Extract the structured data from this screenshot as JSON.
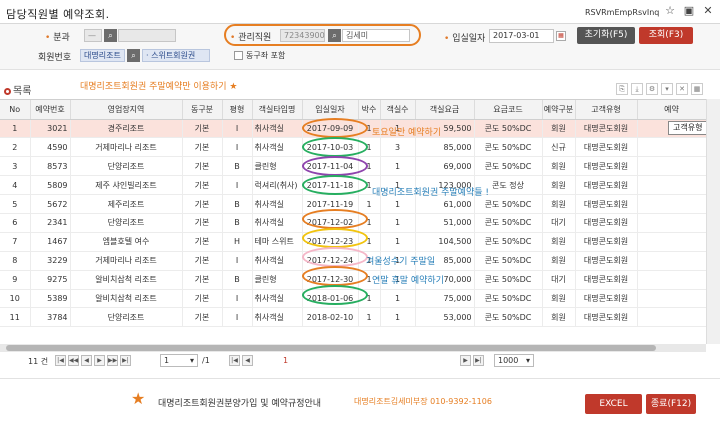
{
  "window": {
    "title": "담당직원별 예약조회.",
    "screen_id": "RSVRmEmpRsvInq"
  },
  "search": {
    "category_label": "분과",
    "category_value": "—",
    "manager_label": "관리직원",
    "manager_code": "72343900",
    "manager_name": "김세미",
    "checkin_label": "입실일자",
    "checkin_date": "2017-03-01",
    "member_no_label": "회원번호",
    "member_tag1": "대명리조트",
    "member_tag2": "스위트회원권",
    "companion_label": "동구좌 포함",
    "reset_label": "초기화(F5)",
    "query_label": "조회(F3)"
  },
  "list": {
    "title": "목록",
    "annotation": "대명리조트회원권 주말예약만 이용하기 ★"
  },
  "columns": [
    "No",
    "예약번호",
    "영업장지역",
    "동구분",
    "평형",
    "객실타입명",
    "입실일자",
    "박수",
    "객실수",
    "객실요금",
    "요금코드",
    "예약구분",
    "고객유형",
    "예약"
  ],
  "rows": [
    {
      "no": "1",
      "rsv": "3021",
      "site": "경주리조트",
      "dong": "기본",
      "py": "I",
      "type": "취사객실",
      "date": "2017-09-09",
      "nights": "1",
      "rooms": "1",
      "fee": "59,500",
      "code": "콘도 50%DC",
      "kind": "회원",
      "cust": "대명콘도회원"
    },
    {
      "no": "2",
      "rsv": "4590",
      "site": "거제마리나 리조트",
      "dong": "기본",
      "py": "I",
      "type": "취사객실",
      "date": "2017-10-03",
      "nights": "1",
      "rooms": "3",
      "fee": "85,000",
      "code": "콘도 50%DC",
      "kind": "신규",
      "cust": "대명콘도회원"
    },
    {
      "no": "3",
      "rsv": "8573",
      "site": "단양리조트",
      "dong": "기본",
      "py": "B",
      "type": "클린형",
      "date": "2017-11-04",
      "nights": "1",
      "rooms": "1",
      "fee": "69,000",
      "code": "콘도 50%DC",
      "kind": "회원",
      "cust": "대명콘도회원"
    },
    {
      "no": "4",
      "rsv": "5809",
      "site": "제주 샤인빌리조트",
      "dong": "기본",
      "py": "I",
      "type": "럭셔리(취사)",
      "date": "2017-11-18",
      "nights": "1",
      "rooms": "1",
      "fee": "123,000",
      "code": "콘도 정상",
      "kind": "회원",
      "cust": "대명콘도회원"
    },
    {
      "no": "5",
      "rsv": "5672",
      "site": "제주리조트",
      "dong": "기본",
      "py": "B",
      "type": "취사객실",
      "date": "2017-11-19",
      "nights": "1",
      "rooms": "1",
      "fee": "61,000",
      "code": "콘도 50%DC",
      "kind": "회원",
      "cust": "대명콘도회원"
    },
    {
      "no": "6",
      "rsv": "2341",
      "site": "단양리조트",
      "dong": "기본",
      "py": "B",
      "type": "취사객실",
      "date": "2017-12-02",
      "nights": "1",
      "rooms": "1",
      "fee": "51,000",
      "code": "콘도 50%DC",
      "kind": "대기",
      "cust": "대명콘도회원"
    },
    {
      "no": "7",
      "rsv": "1467",
      "site": "엠블호텔 여수",
      "dong": "기본",
      "py": "H",
      "type": "테마 스위트",
      "date": "2017-12-23",
      "nights": "1",
      "rooms": "1",
      "fee": "104,500",
      "code": "콘도 50%DC",
      "kind": "회원",
      "cust": "대명콘도회원"
    },
    {
      "no": "8",
      "rsv": "3229",
      "site": "거제마리나 리조트",
      "dong": "기본",
      "py": "I",
      "type": "취사객실",
      "date": "2017-12-24",
      "nights": "1",
      "rooms": "1",
      "fee": "85,000",
      "code": "콘도 50%DC",
      "kind": "회원",
      "cust": "대명콘도회원"
    },
    {
      "no": "9",
      "rsv": "9275",
      "site": "알비치삼척 리조트",
      "dong": "기본",
      "py": "B",
      "type": "클린형",
      "date": "2017-12-30",
      "nights": "1",
      "rooms": "1",
      "fee": "70,000",
      "code": "콘도 50%DC",
      "kind": "대기",
      "cust": "대명콘도회원"
    },
    {
      "no": "10",
      "rsv": "5389",
      "site": "알비치삼척 리조트",
      "dong": "기본",
      "py": "I",
      "type": "취사객실",
      "date": "2018-01-06",
      "nights": "1",
      "rooms": "1",
      "fee": "75,000",
      "code": "콘도 50%DC",
      "kind": "회원",
      "cust": "대명콘도회원"
    },
    {
      "no": "11",
      "rsv": "3784",
      "site": "단양리조트",
      "dong": "기본",
      "py": "I",
      "type": "취사객실",
      "date": "2018-02-10",
      "nights": "1",
      "rooms": "1",
      "fee": "53,000",
      "code": "콘도 50%DC",
      "kind": "회원",
      "cust": "대명콘도회원"
    }
  ],
  "notes": {
    "saturday": "토요일만 예약하기",
    "weekend": "대명리조트회원권 주말예약들 !",
    "winter": "겨울성수기 주말일",
    "yearend": "연말 휴말 예약하기"
  },
  "tooltip": "고객유형",
  "pager": {
    "count": "11 건",
    "page": "1",
    "total": "/1",
    "current": "1",
    "page_size": "1000"
  },
  "footer": {
    "guide": "대명리조트회원권분양가입 및 예약규정안내",
    "contact": "대명리조트김세미부장 010-9392-1106",
    "excel_label": "EXCEL",
    "close_label": "종료(F12)"
  },
  "colors": {
    "accent": "#e67e22",
    "red": "#c0392b",
    "green": "#27ae60",
    "purple": "#8e44ad",
    "yellow": "#f1c40f",
    "blue": "#2980b9"
  }
}
